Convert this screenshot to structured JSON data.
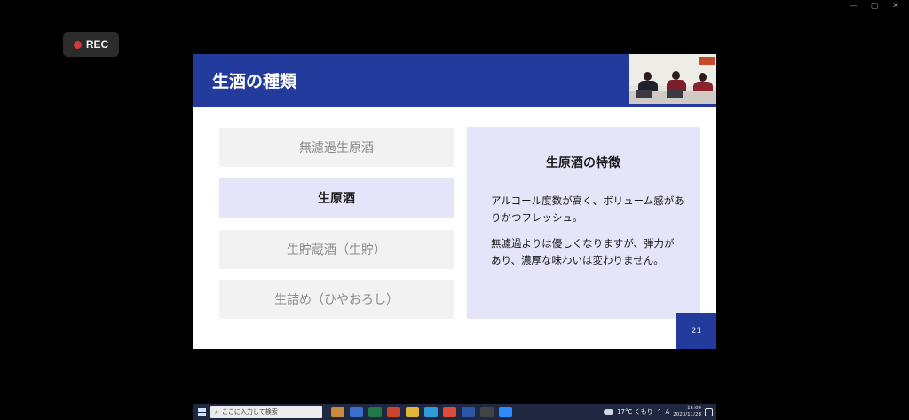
{
  "window_controls": [
    "—",
    "▢",
    "✕"
  ],
  "recording": {
    "label": "REC"
  },
  "slide": {
    "title": "生酒の種類",
    "categories": [
      {
        "label": "無濾過生原酒",
        "active": false
      },
      {
        "label": "生原酒",
        "active": true
      },
      {
        "label": "生貯蔵酒（生貯）",
        "active": false
      },
      {
        "label": "生詰め（ひやおろし）",
        "active": false
      }
    ],
    "detail": {
      "title": "生原酒の特徴",
      "paragraphs": [
        "アルコール度数が高く、ボリューム感がありかつフレッシュ。",
        "無濾過よりは優しくなりますが、弾力があり、濃厚な味わいは変わりません。"
      ]
    },
    "page_number": "21"
  },
  "taskbar": {
    "search_placeholder": "ここに入力して検索",
    "weather": "17°C くもり",
    "ime": "A",
    "time": "15:09",
    "date": "2023/11/28"
  },
  "colors": {
    "title_bar": "#233b9c",
    "highlight": "#e5e5fa",
    "inactive": "#f2f2f2"
  }
}
